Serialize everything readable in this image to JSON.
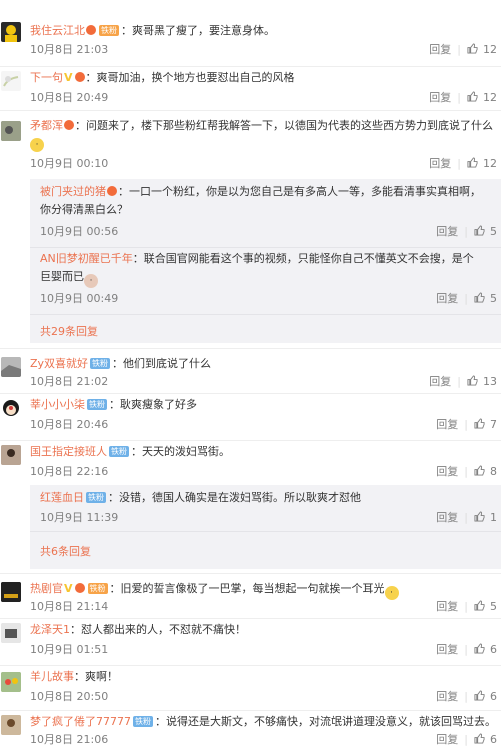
{
  "comments": [
    {
      "user": "我住云江北",
      "badge": "铁粉",
      "text": "：爽哥黑了瘦了，要注意身体。",
      "time": "10月8日 21:03",
      "reply": "回复",
      "likes": "12"
    },
    {
      "user": "下一句",
      "text": "：爽哥加油，换个地方也要怼出自己的风格",
      "time": "10月8日 20:49",
      "reply": "回复",
      "likes": "12"
    },
    {
      "user": "矛都浑",
      "text": "：问题来了，楼下那些粉红帮我解答一下，以德国为代表的这些西方势力到底说了什么",
      "time": "10月9日 00:10",
      "reply": "回复",
      "likes": "12"
    },
    {
      "user": "Zy双喜就好",
      "badge": "铁粉",
      "text": "：他们到底说了什么",
      "time": "10月8日 21:02",
      "reply": "回复",
      "likes": "13"
    },
    {
      "user": "莘小小小柒",
      "badge": "铁粉",
      "text": "：耿爽瘦象了好多",
      "time": "10月8日 20:46",
      "reply": "回复",
      "likes": "7"
    },
    {
      "user": "国王指定接班人",
      "badge": "铁粉",
      "text": "：天天的泼妇骂街。",
      "time": "10月8日 22:16",
      "reply": "回复",
      "likes": "8"
    },
    {
      "user": "热剧官",
      "badge": "铁粉",
      "text": "：旧爱的誓言像极了一巴掌，每当想起一句就挨一个耳光",
      "time": "10月8日 21:14",
      "reply": "回复",
      "likes": "5"
    },
    {
      "user": "龙泽天1",
      "text": "：怼人都出来的人，不怼就不痛快！",
      "time": "10月9日 01:51",
      "reply": "回复",
      "likes": "6"
    },
    {
      "user": "羊儿故事",
      "text": "：爽啊！",
      "time": "10月8日 20:50",
      "reply": "回复",
      "likes": "6"
    },
    {
      "user": "梦了疯了倦了77777",
      "badge": "铁粉",
      "text": "：说得还是大斯文，不够痛快，对流氓讲道理没意义，就该回骂过去。",
      "time": "10月8日 21:06",
      "reply": "回复",
      "likes": "6"
    }
  ],
  "replies": [
    {
      "user": "被门夹过的猪",
      "text": "：一口一个粉红，你是以为您自己是有多高人一等，多能看清事实真相啊，你分得清黑白么？",
      "time": "10月9日 00:56",
      "reply": "回复",
      "likes": "5"
    },
    {
      "user": "AN旧梦初醒已千年",
      "text": "：联合国官网能看这个事的视频，只能怪你自己不懂英文不会搜，是个巨婴而已",
      "time": "10月9日 00:49",
      "reply": "回复",
      "likes": "5"
    },
    {
      "user": "红莲血日",
      "badge": "铁粉",
      "text": "：没错，德国人确实是在泼妇骂街。所以耿爽才怼他",
      "time": "10月9日 11:39",
      "reply": "回复",
      "likes": "1"
    }
  ],
  "more_links": [
    "共29条回复",
    "共6条回复"
  ],
  "colors": {
    "username": "#eb7350",
    "meta": "#808080",
    "reply_bg": "#f2f2f5",
    "fans_badge": "#6fb1e8"
  }
}
